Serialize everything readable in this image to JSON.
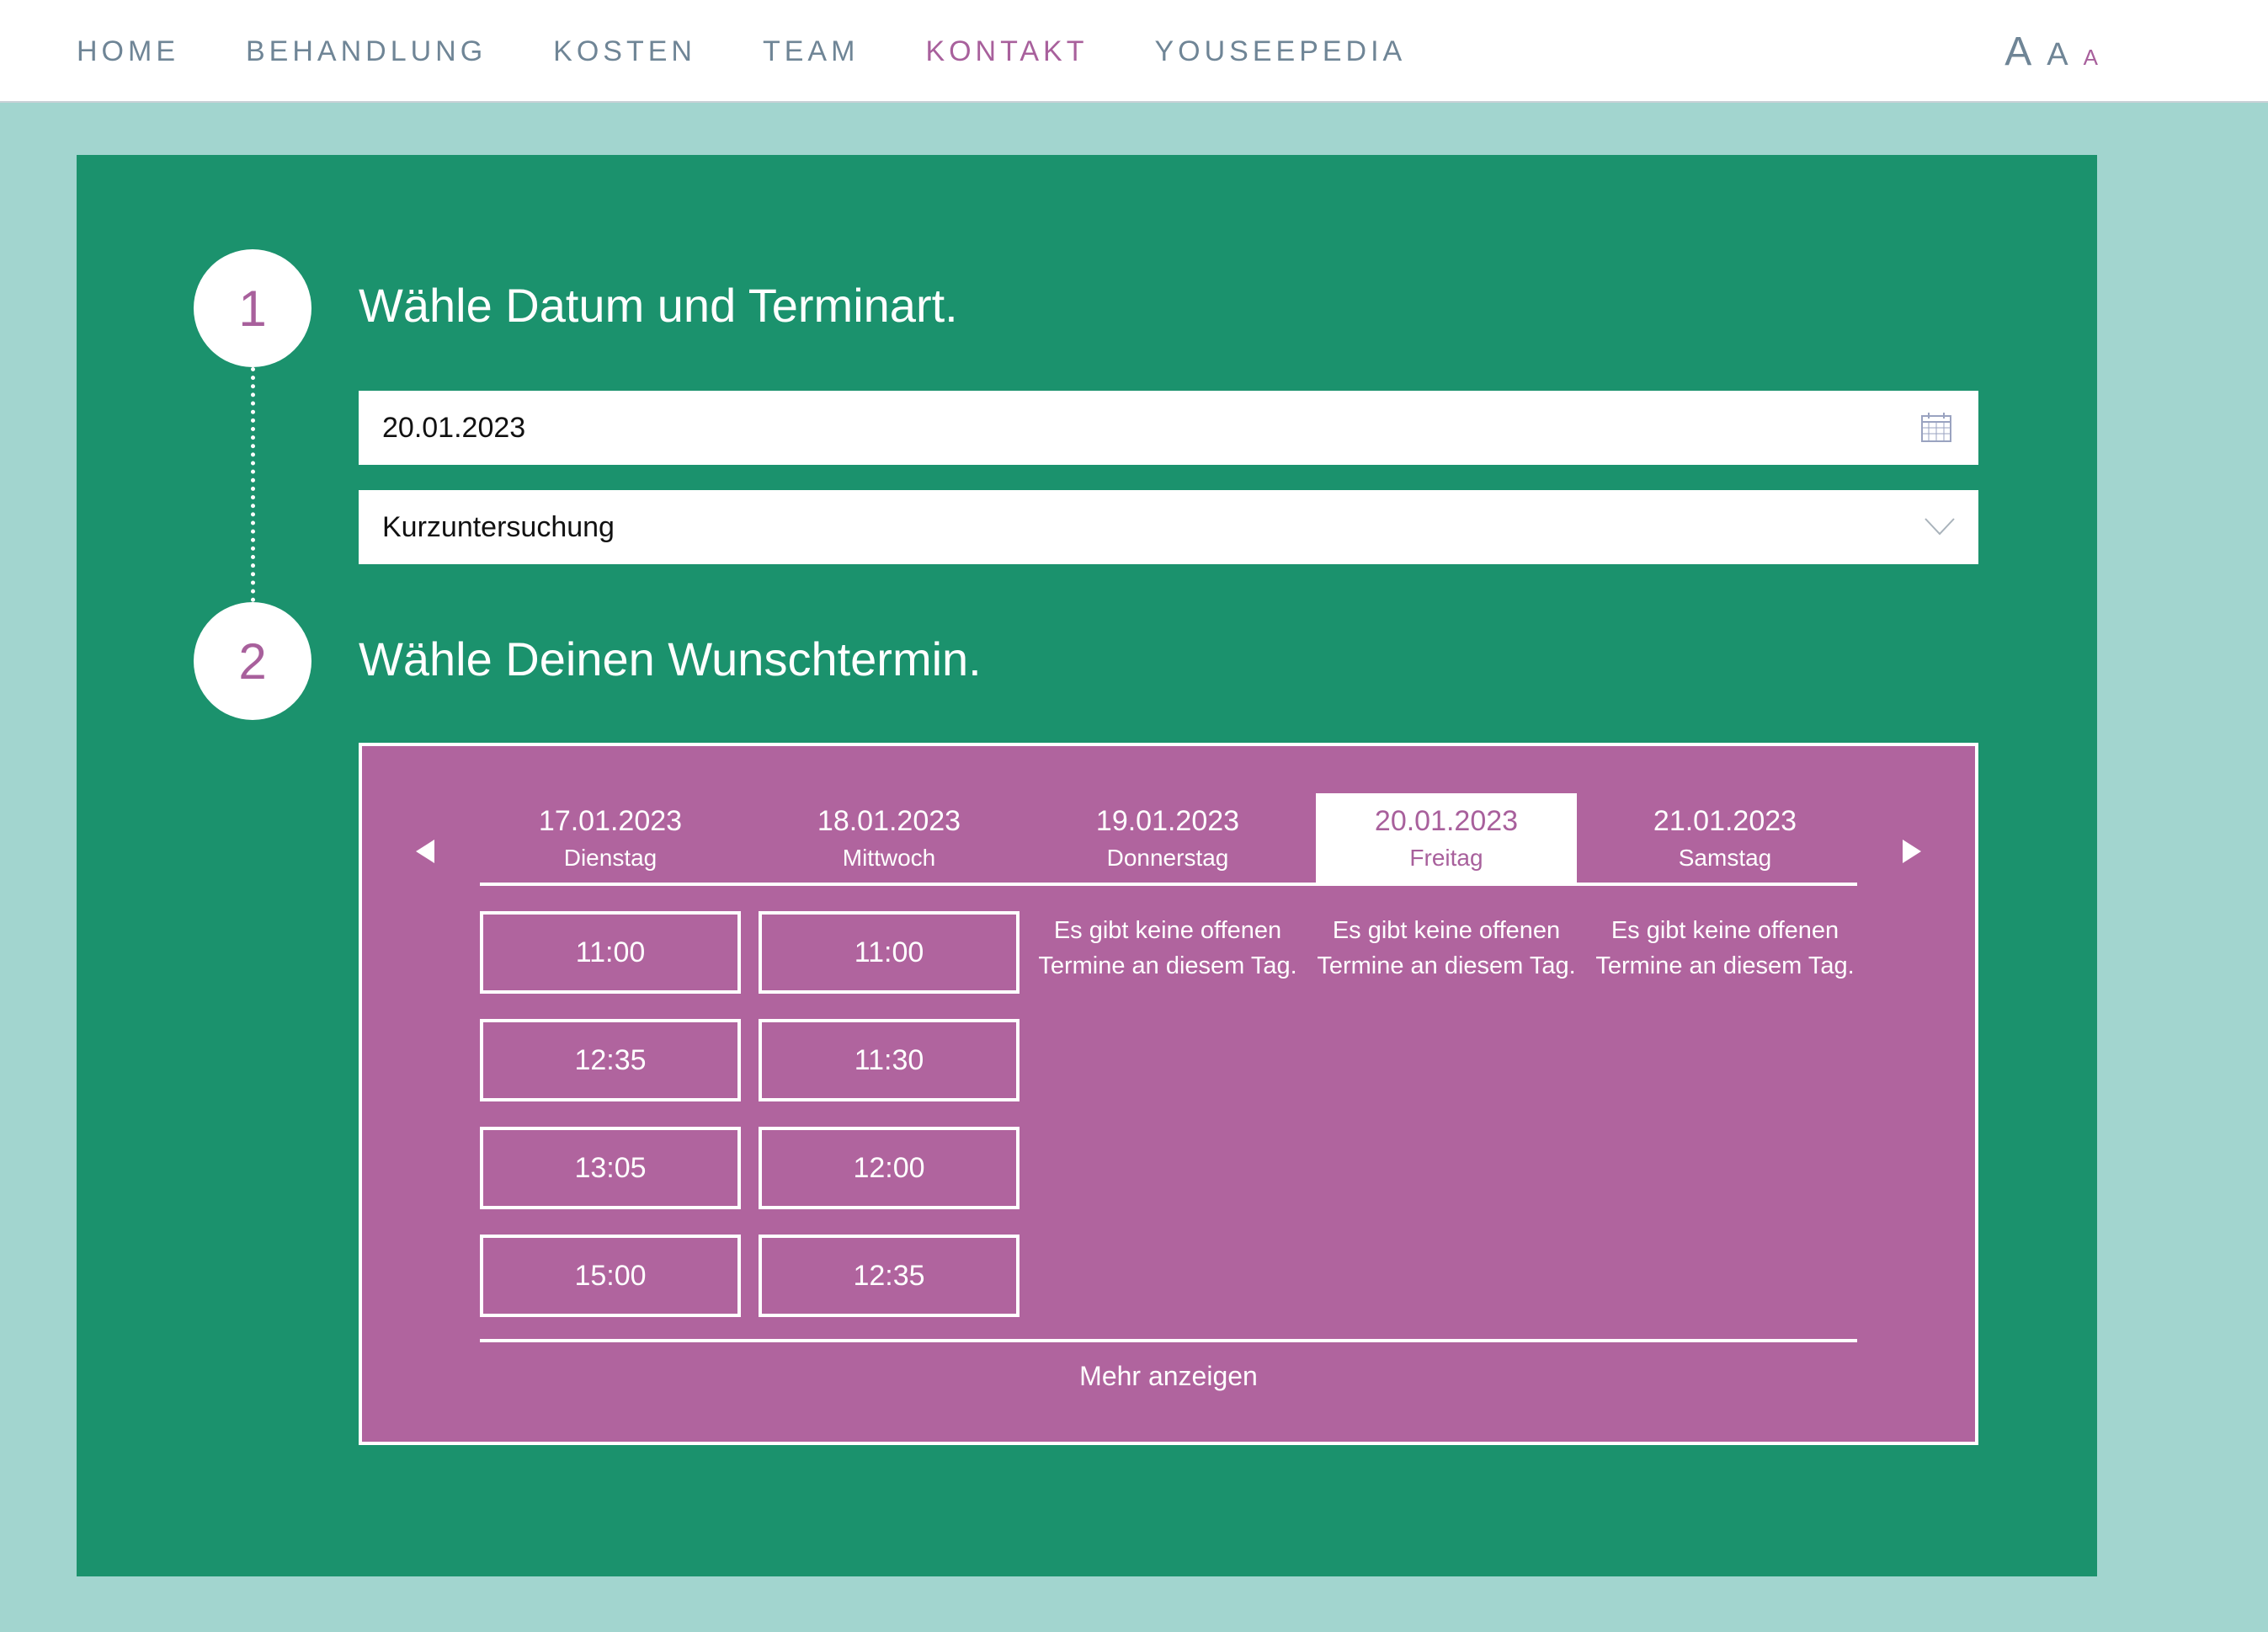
{
  "nav": {
    "items": [
      "HOME",
      "BEHANDLUNG",
      "KOSTEN",
      "TEAM",
      "KONTAKT",
      "YOUSEEPEDIA"
    ],
    "active_index": 4,
    "font_size_options": [
      "A",
      "A",
      "A"
    ],
    "active_color": "#a8609c"
  },
  "steps": {
    "one": {
      "number": "1",
      "title": "Wähle Datum und Terminart."
    },
    "two": {
      "number": "2",
      "title": "Wähle Deinen Wunschtermin."
    }
  },
  "form": {
    "date_value": "20.01.2023",
    "date_icon": "calendar-icon",
    "type_value": "Kurzuntersuchung",
    "type_icon": "chevron-down-icon"
  },
  "calendar": {
    "prev_icon": "triangle-left-icon",
    "next_icon": "triangle-right-icon",
    "days": [
      {
        "date": "17.01.2023",
        "weekday": "Dienstag"
      },
      {
        "date": "18.01.2023",
        "weekday": "Mittwoch"
      },
      {
        "date": "19.01.2023",
        "weekday": "Donnerstag"
      },
      {
        "date": "20.01.2023",
        "weekday": "Freitag"
      },
      {
        "date": "21.01.2023",
        "weekday": "Samstag"
      }
    ],
    "selected_index": 3,
    "slots_day1": [
      "11:00",
      "12:35",
      "13:05",
      "15:00"
    ],
    "slots_day2": [
      "11:00",
      "11:30",
      "12:00",
      "12:35"
    ],
    "no_slots_text": "Es gibt keine offenen Termine an diesem Tag.",
    "more_label": "Mehr anzeigen"
  },
  "colors": {
    "page_bg": "#a2d5cf",
    "panel_green": "#1b926d",
    "booking_purple": "#b0649e",
    "nav_text": "#6f8596"
  }
}
